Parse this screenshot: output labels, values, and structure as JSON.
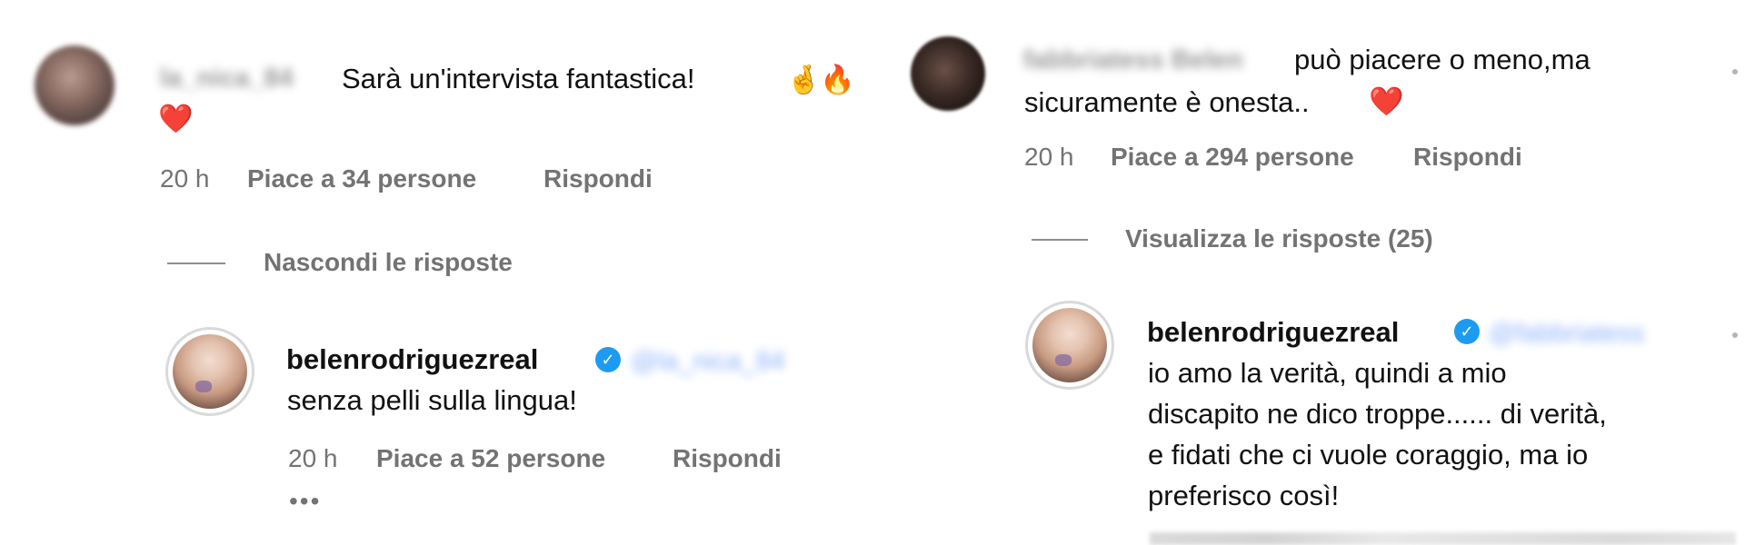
{
  "left": {
    "comment": {
      "username": "la_nica_84",
      "text_line1": "Sarà un'intervista fantastica!",
      "emoji_line1": [
        "crossed-fingers-emoji",
        "fire-emoji"
      ],
      "emoji_line2": [
        "red-heart-emoji"
      ],
      "time": "20 h",
      "likes": "Piace a 34 persone",
      "reply_label": "Rispondi"
    },
    "thread_toggle": "Nascondi le risposte",
    "reply": {
      "username": "belenrodriguezreal",
      "mention": "@la_nica_84",
      "text_line1": "senza pelli sulla lingua!",
      "time": "20 h",
      "likes": "Piace a 52 persone",
      "reply_label": "Rispondi",
      "more_label": "•••"
    }
  },
  "right": {
    "comment": {
      "username": "fabbriatess Belen",
      "text_line1": "può piacere o meno,ma",
      "text_line2": "sicuramente è onesta..",
      "emoji_line2": [
        "red-heart-emoji"
      ],
      "time": "20 h",
      "likes": "Piace a 294 persone",
      "reply_label": "Rispondi"
    },
    "thread_toggle": "Visualizza le risposte (25)",
    "reply": {
      "username": "belenrodriguezreal",
      "mention": "@fabbriatess",
      "text_lines": [
        "io amo la verità, quindi a mio",
        "discapito ne dico troppe...... di verità,",
        "e fidati che ci vuole coraggio, ma io",
        "preferisco così!"
      ]
    }
  },
  "icons": {
    "verified": "verified-badge-icon",
    "heart": "heart-emoji",
    "fire": "fire-emoji",
    "crossed_fingers": "crossed-fingers-emoji"
  },
  "colors": {
    "text": "#111111",
    "meta": "#737373",
    "divider": "#8e8e8e",
    "verified": "#1d9bf0",
    "heart": "#e0153d"
  }
}
